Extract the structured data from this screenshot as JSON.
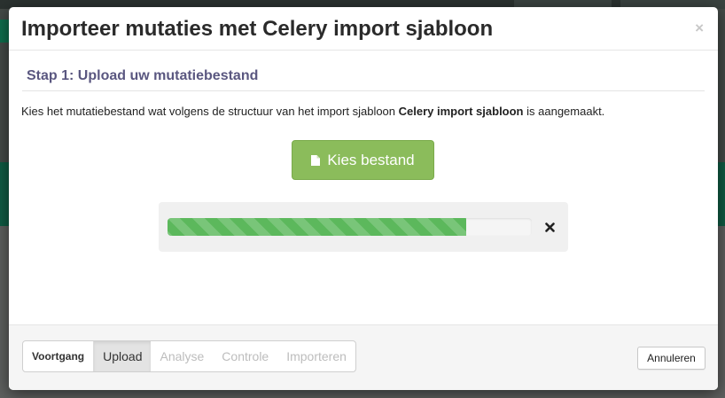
{
  "modal": {
    "title": "Importeer mutaties met Celery import sjabloon",
    "close_symbol": "×"
  },
  "step": {
    "heading": "Stap 1: Upload uw mutatiebestand",
    "description_prefix": "Kies het mutatiebestand wat volgens de structuur van het import sjabloon ",
    "description_template_name": "Celery import sjabloon",
    "description_suffix": " is aangemaakt."
  },
  "upload": {
    "choose_button_label": "Kies bestand",
    "choose_button_icon": "file-icon",
    "progress_fraction": 0.82,
    "cancel_icon": "close-icon"
  },
  "footer": {
    "steps": [
      "Voortgang",
      "Upload",
      "Analyse",
      "Controle",
      "Importeren"
    ],
    "active_step": "Upload",
    "cancel_label": "Annuleren"
  },
  "colors": {
    "heading": "#5a5780",
    "choose_button": "#8bbc5b",
    "progress": "#5cb85c"
  }
}
